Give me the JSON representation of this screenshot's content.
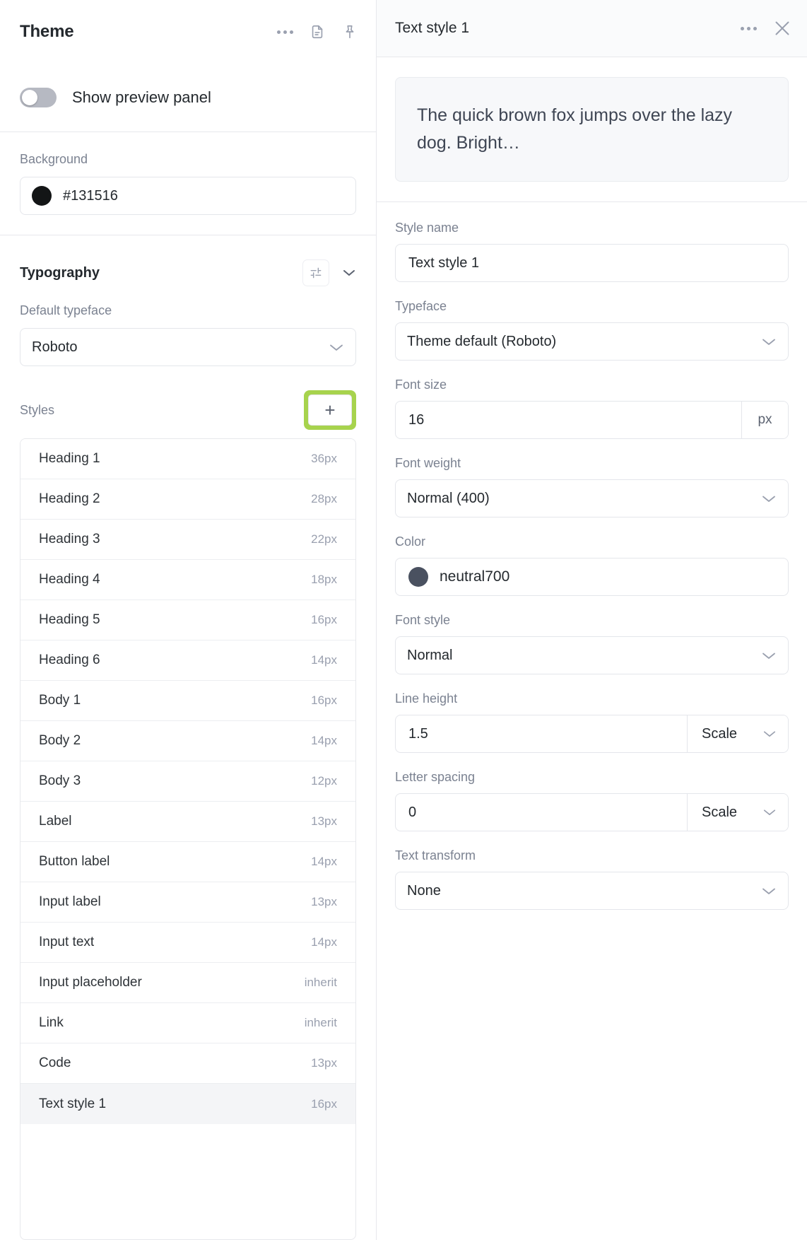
{
  "left_panel": {
    "title": "Theme",
    "header_icons": [
      {
        "name": "more-options-icon",
        "glyph": "•••"
      },
      {
        "name": "document-icon",
        "glyph": "document"
      },
      {
        "name": "pin-icon",
        "glyph": "pin"
      }
    ],
    "preview_toggle": {
      "label": "Show preview panel",
      "state": "off"
    },
    "background": {
      "label": "Background",
      "value": "#131516",
      "swatch_color": "#131516"
    },
    "typography": {
      "title": "Typography",
      "tools": [
        {
          "name": "sliders-settings-icon"
        },
        {
          "name": "chevron-down-icon"
        }
      ],
      "default_typeface": {
        "label": "Default typeface",
        "value": "Roboto"
      },
      "styles": {
        "label": "Styles",
        "add_button_label": "+",
        "add_button_highlight_color": "#a7d34d",
        "items": [
          {
            "name": "Heading 1",
            "size": "36px",
            "selected": false
          },
          {
            "name": "Heading 2",
            "size": "28px",
            "selected": false
          },
          {
            "name": "Heading 3",
            "size": "22px",
            "selected": false
          },
          {
            "name": "Heading 4",
            "size": "18px",
            "selected": false
          },
          {
            "name": "Heading 5",
            "size": "16px",
            "selected": false
          },
          {
            "name": "Heading 6",
            "size": "14px",
            "selected": false
          },
          {
            "name": "Body 1",
            "size": "16px",
            "selected": false
          },
          {
            "name": "Body 2",
            "size": "14px",
            "selected": false
          },
          {
            "name": "Body 3",
            "size": "12px",
            "selected": false
          },
          {
            "name": "Label",
            "size": "13px",
            "selected": false
          },
          {
            "name": "Button label",
            "size": "14px",
            "selected": false
          },
          {
            "name": "Input label",
            "size": "13px",
            "selected": false
          },
          {
            "name": "Input text",
            "size": "14px",
            "selected": false
          },
          {
            "name": "Input placeholder",
            "size": "inherit",
            "selected": false
          },
          {
            "name": "Link",
            "size": "inherit",
            "selected": false
          },
          {
            "name": "Code",
            "size": "13px",
            "selected": false
          },
          {
            "name": "Text style 1",
            "size": "16px",
            "selected": true
          }
        ]
      }
    }
  },
  "right_panel": {
    "title": "Text style 1",
    "header_icons": [
      {
        "name": "more-options-icon",
        "glyph": "•••"
      },
      {
        "name": "close-icon",
        "glyph": "×"
      }
    ],
    "preview_text": "The quick brown fox jumps over the lazy dog. Bright…",
    "fields": {
      "style_name": {
        "label": "Style name",
        "value": "Text style 1"
      },
      "typeface": {
        "label": "Typeface",
        "value": "Theme default (Roboto)"
      },
      "font_size": {
        "label": "Font size",
        "value": "16",
        "unit": "px"
      },
      "font_weight": {
        "label": "Font weight",
        "value": "Normal (400)"
      },
      "color": {
        "label": "Color",
        "value": "neutral700",
        "swatch_color": "#4a5160"
      },
      "font_style": {
        "label": "Font style",
        "value": "Normal"
      },
      "line_height": {
        "label": "Line height",
        "value": "1.5",
        "unit": "Scale"
      },
      "letter_spacing": {
        "label": "Letter spacing",
        "value": "0",
        "unit": "Scale"
      },
      "text_transform": {
        "label": "Text transform",
        "value": "None"
      }
    }
  }
}
